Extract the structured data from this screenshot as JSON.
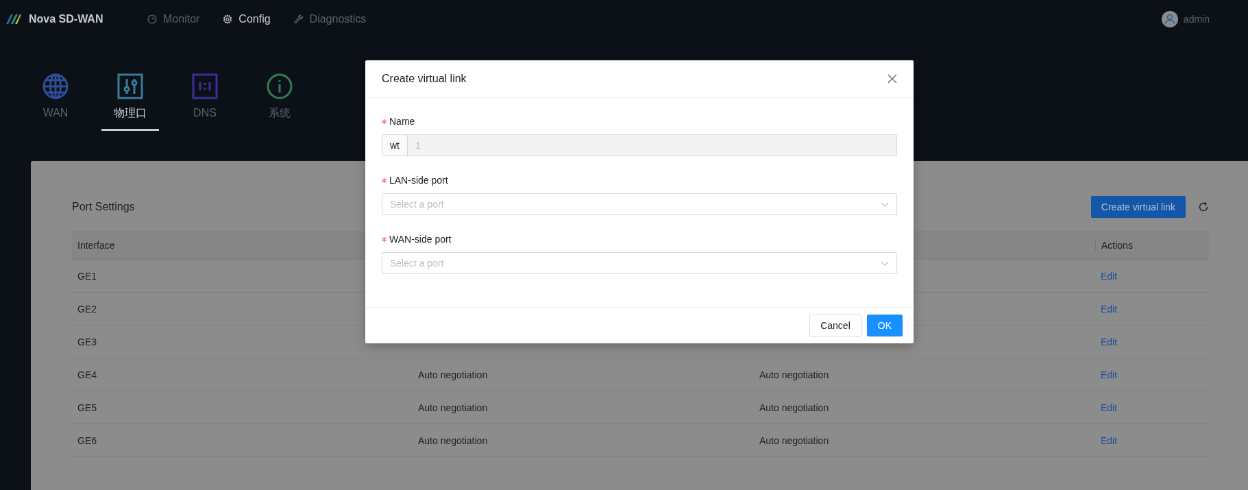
{
  "brand": "Nova SD-WAN",
  "nav": [
    {
      "label": "Monitor",
      "selected": false
    },
    {
      "label": "Config",
      "selected": true
    },
    {
      "label": "Diagnostics",
      "selected": false
    }
  ],
  "user": {
    "name": "admin"
  },
  "sections": [
    {
      "label": "WAN",
      "selected": false
    },
    {
      "label": "物理口",
      "selected": true
    },
    {
      "label": "DNS",
      "selected": false
    },
    {
      "label": "系统",
      "selected": false
    }
  ],
  "card": {
    "title": "Port Settings",
    "primary_button": "Create virtual link",
    "table": {
      "columns": {
        "column_1": "Interface",
        "column_4": "Actions"
      },
      "rows": [
        {
          "column_1": "GE1",
          "column_4": "Edit"
        },
        {
          "column_1": "GE2",
          "column_4": "Edit"
        },
        {
          "column_1": "GE3",
          "column_4": "Edit"
        },
        {
          "column_1": "GE4",
          "column_2": "Auto negotiation",
          "column_3": "Auto negotiation",
          "column_4": "Edit"
        },
        {
          "column_1": "GE5",
          "column_2": "Auto negotiation",
          "column_3": "Auto negotiation",
          "column_4": "Edit"
        },
        {
          "column_1": "GE6",
          "column_2": "Auto negotiation",
          "column_3": "Auto negotiation",
          "column_4": "Edit"
        }
      ]
    }
  },
  "dialog": {
    "title": "Create virtual link",
    "fields": [
      {
        "kind": "addon",
        "label": "Name",
        "required": true,
        "addon": "wt",
        "value": "1",
        "disabled": true
      },
      {
        "kind": "select",
        "label": "LAN-side port",
        "required": true,
        "placeholder": "Select a port"
      },
      {
        "kind": "select",
        "label": "WAN-side port",
        "required": true,
        "placeholder": "Select a port"
      }
    ],
    "buttons": [
      {
        "label": "Cancel",
        "kind": "default"
      },
      {
        "label": "OK",
        "kind": "primary"
      }
    ]
  }
}
